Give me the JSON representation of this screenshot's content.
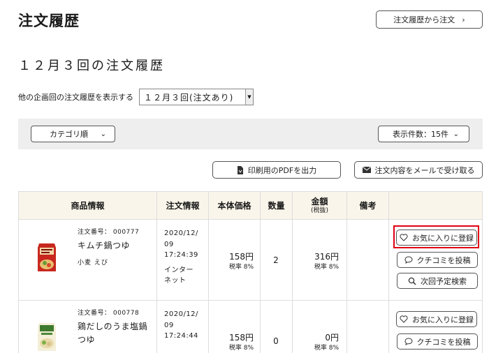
{
  "page": {
    "title": "注文履歴",
    "order_from_history_button": "注文履歴から注文",
    "subtitle": "１２月３回の注文履歴"
  },
  "period_selector": {
    "label": "他の企画回の注文履歴を表示する",
    "value": "１２月３回(注文あり)"
  },
  "filters": {
    "sort_label": "カテゴリ順",
    "count_label": "表示件数：15件"
  },
  "actions": {
    "pdf_label": "印刷用のPDFを出力",
    "mail_label": "注文内容をメールで受け取る"
  },
  "table": {
    "headers": {
      "product": "商品情報",
      "order": "注文情報",
      "unit_price": "本体価格",
      "quantity": "数量",
      "amount": "金額",
      "amount_note": "(税抜)",
      "remarks": "備考"
    },
    "rows": [
      {
        "order_no": "注文番号： 000777",
        "name_line1": "キムチ鍋つゆ",
        "name_line2": "",
        "allergen": "小麦 えび",
        "date": "2020/12/",
        "day": "09",
        "time": "17:24:39",
        "channel1": "インター",
        "channel2": "ネット",
        "unit_price": "158円",
        "unit_tax": "税率 8%",
        "quantity": "2",
        "amount": "316円",
        "amount_tax": "税率 8%",
        "favorite_label": "お気に入りに登録",
        "review_label": "クチコミを投稿",
        "schedule_label": "次回予定検索"
      },
      {
        "order_no": "注文番号： 000778",
        "name_line1": "鶏だしのうま塩鍋",
        "name_line2": "つゆ",
        "allergen": "",
        "date": "2020/12/",
        "day": "09",
        "time": "17:24:44",
        "channel1": "",
        "channel2": "",
        "unit_price": "158円",
        "unit_tax": "税率 8%",
        "quantity": "0",
        "amount": "0円",
        "amount_tax": "税率 8%",
        "favorite_label": "お気に入りに登録",
        "review_label": "クチコミを投稿",
        "schedule_label": ""
      }
    ]
  },
  "colors": {
    "header_bg": "#faf5ea",
    "filter_bar_bg": "#eeeeee",
    "highlight_border": "#e00012"
  }
}
